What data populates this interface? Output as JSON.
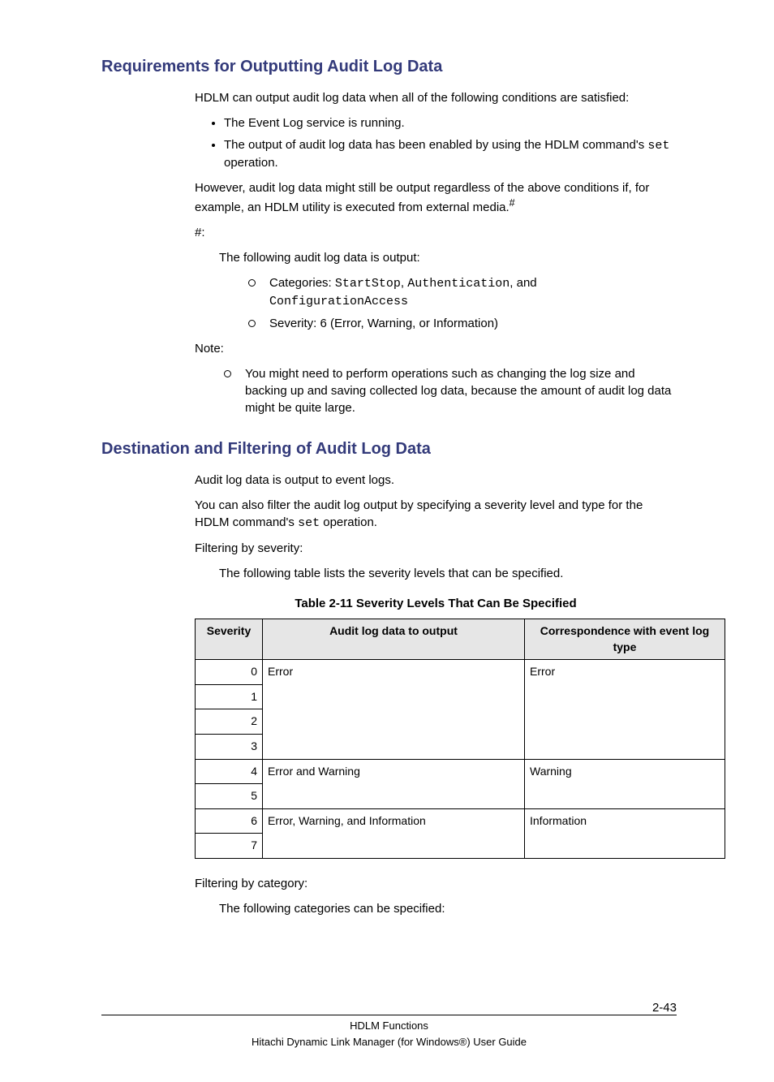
{
  "section1": {
    "heading": "Requirements for Outputting Audit Log Data",
    "intro": "HDLM can output audit log data when all of the following conditions are satisfied:",
    "bullets": {
      "b1": "The Event Log service is running.",
      "b2_pre": "The output of audit log data has been enabled by using the HDLM command's ",
      "b2_code": "set",
      "b2_post": " operation."
    },
    "however_pre": "However, audit log data might still be output regardless of the above conditions if, for example, an HDLM utility is executed from external media.",
    "hash_sup": "#",
    "hash_label": "#:",
    "hash_intro": "The following audit log data is output:",
    "hash_items": {
      "cat_label": "Categories: ",
      "cat_code1": "StartStop",
      "cat_sep1": ", ",
      "cat_code2": "Authentication",
      "cat_sep2": ", and ",
      "cat_code3": "ConfigurationAccess",
      "sev": "Severity: 6 (Error, Warning, or Information)"
    },
    "note_label": "Note:",
    "note_item": "You might need to perform operations such as changing the log size and backing up and saving collected log data, because the amount of audit log data might be quite large."
  },
  "section2": {
    "heading": "Destination and Filtering of Audit Log Data",
    "p1": "Audit log data is output to event logs.",
    "p2_pre": "You can also filter the audit log output by specifying a severity level and type for the HDLM command's ",
    "p2_code": "set",
    "p2_post": " operation.",
    "sev_label": "Filtering by severity:",
    "sev_intro": "The following table lists the severity levels that can be specified.",
    "table_caption": "Table 2-11 Severity Levels That Can Be Specified",
    "table": {
      "h1": "Severity",
      "h2": "Audit log data to output",
      "h3": "Correspondence with event log type",
      "s0": "0",
      "s1": "1",
      "s2": "2",
      "s3": "3",
      "s4": "4",
      "s5": "5",
      "s6": "6",
      "s7": "7",
      "out_a": "Error",
      "out_b": "Error and Warning",
      "out_c": "Error, Warning, and Information",
      "corr_a": "Error",
      "corr_b": "Warning",
      "corr_c": "Information"
    },
    "cat_label": "Filtering by category:",
    "cat_intro": "The following categories can be specified:"
  },
  "footer": {
    "line1": "HDLM Functions",
    "line2": "Hitachi Dynamic Link Manager (for Windows®) User Guide",
    "page": "2-43"
  }
}
